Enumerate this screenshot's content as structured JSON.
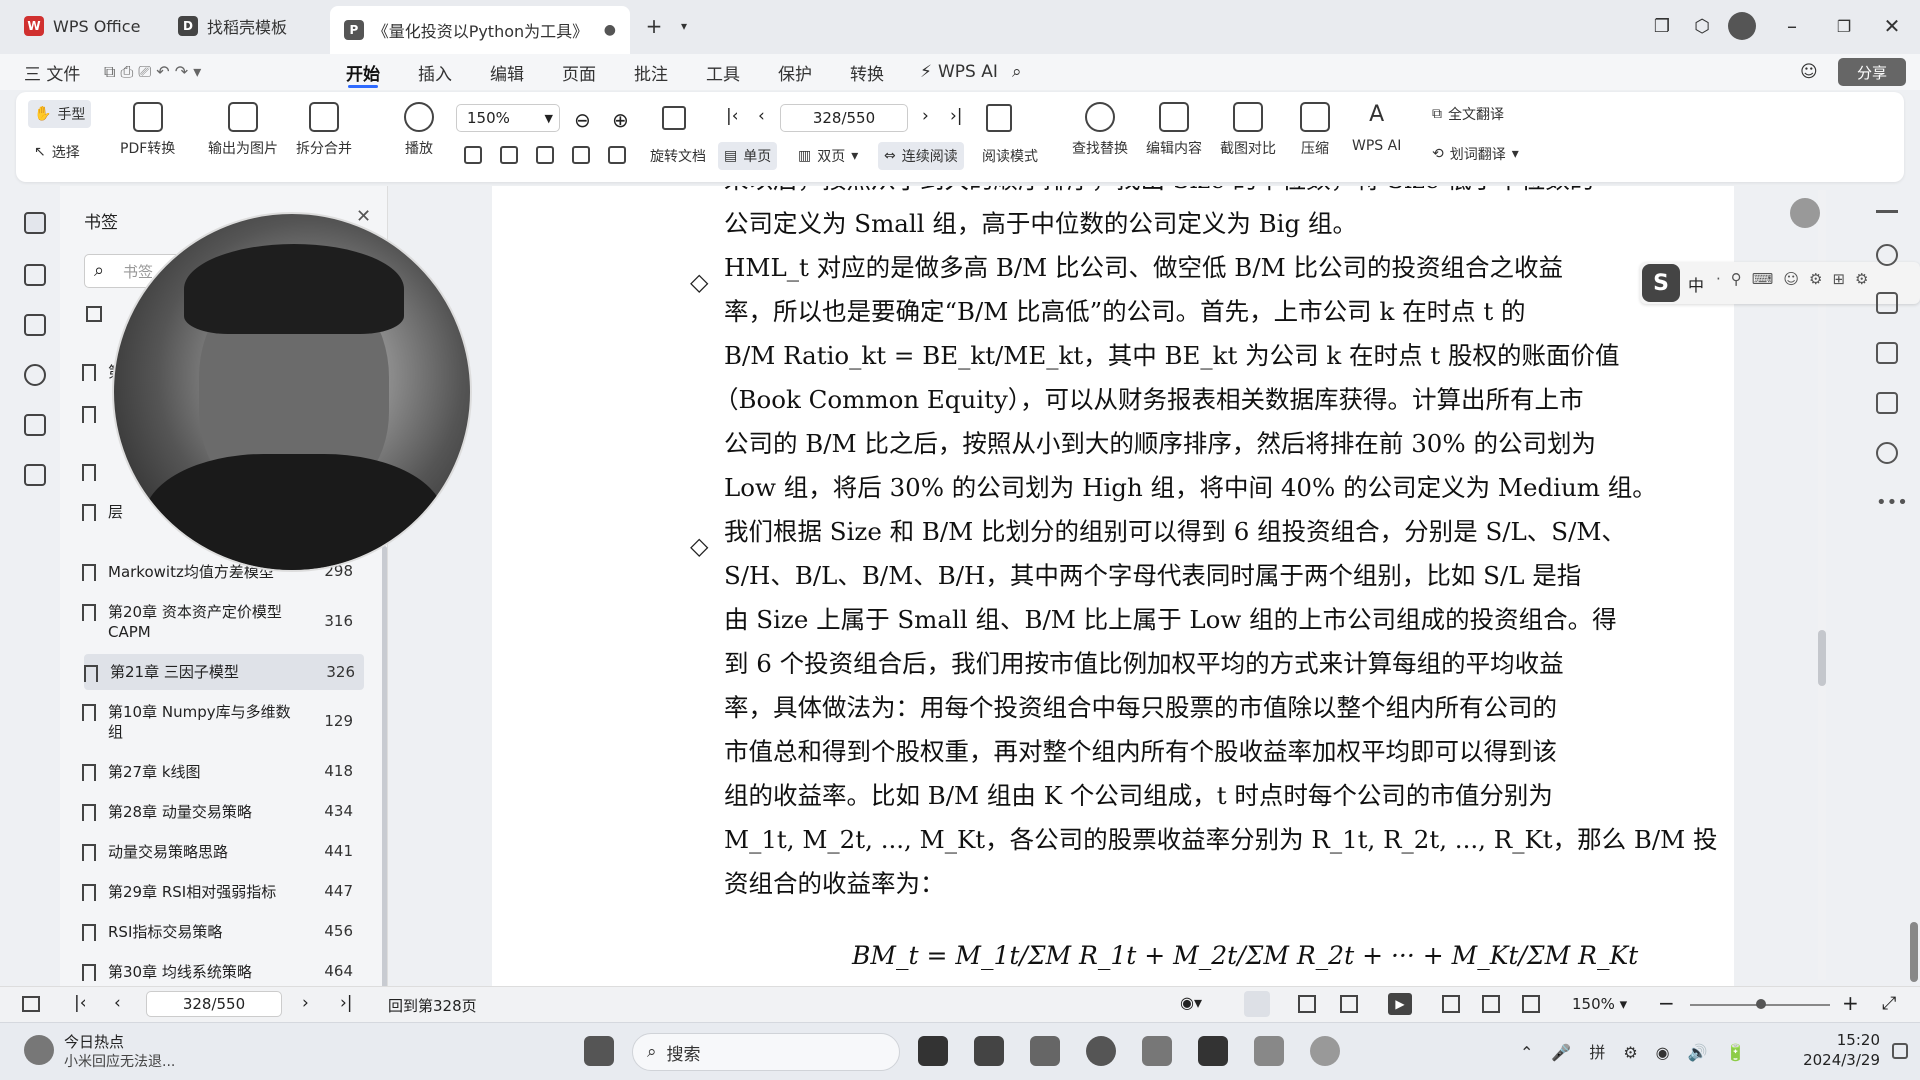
{
  "tabs": [
    {
      "label": "WPS Office",
      "icon": "wps-logo-icon"
    },
    {
      "label": "找稻壳模板",
      "icon": "docer-icon"
    },
    {
      "label": "《量化投资以Python为工具》",
      "icon": "pdf-doc-icon"
    }
  ],
  "menu": {
    "file": "三 文件",
    "items": [
      "开始",
      "插入",
      "编辑",
      "页面",
      "批注",
      "工具",
      "保护",
      "转换"
    ],
    "wps_ai": "WPS AI",
    "share": "分享",
    "active": "开始"
  },
  "ribbon": {
    "hand": "手型",
    "select": "选择",
    "pdf_convert": "PDF转换",
    "export_img": "输出为图片",
    "split_merge": "拆分合并",
    "play": "播放",
    "zoom": "150%",
    "page_value": "328/550",
    "rotate": "旋转文档",
    "single": "单页",
    "double": "双页",
    "continuous": "连续阅读",
    "reading": "阅读模式",
    "find_replace": "查找替换",
    "edit_content": "编辑内容",
    "screenshot": "截图对比",
    "compress": "压缩",
    "wps_ai": "WPS AI",
    "full_translate": "全文翻译",
    "word_translate": "划词翻译"
  },
  "bookmarks": {
    "title": "书签",
    "search_placeholder": "书签",
    "items": [
      {
        "title": "第1",
        "page": ""
      },
      {
        "title": "层",
        "page": ""
      },
      {
        "title": "Markowitz均值方差模型",
        "page": "298"
      },
      {
        "title": "第20章 资本资产定价模型 CAPM",
        "page": "316"
      },
      {
        "title": "第21章 三因子模型",
        "page": "326"
      },
      {
        "title": "第10章 Numpy库与多维数组",
        "page": "129"
      },
      {
        "title": "第27章 k线图",
        "page": "418"
      },
      {
        "title": "第28章 动量交易策略",
        "page": "434"
      },
      {
        "title": "动量交易策略思路",
        "page": "441"
      },
      {
        "title": "第29章 RSI相对强弱指标",
        "page": "447"
      },
      {
        "title": "RSI指标交易策略",
        "page": "456"
      },
      {
        "title": "第30章 均线系统策略",
        "page": "464"
      }
    ]
  },
  "document": {
    "lines": [
      "来以后，按照从小到大的顺序排序，找出 Size 的中位数，将 Size 低于中位数的",
      "公司定义为 Small 组，高于中位数的公司定义为 Big 组。",
      "HML_t 对应的是做多高 B/M 比公司、做空低 B/M 比公司的投资组合之收益",
      "率，所以也是要确定“B/M 比高低”的公司。首先，上市公司 k 在时点 t 的",
      "B/M Ratio_kt = BE_kt/ME_kt，其中 BE_kt 为公司 k 在时点 t 股权的账面价值",
      "（Book Common Equity），可以从财务报表相关数据库获得。计算出所有上市",
      "公司的 B/M 比之后，按照从小到大的顺序排序，然后将排在前 30% 的公司划为",
      "Low 组，将后 30% 的公司划为 High 组，将中间 40% 的公司定义为 Medium 组。",
      "我们根据 Size 和 B/M 比划分的组别可以得到 6 组投资组合，分别是 S/L、S/M、",
      "S/H、B/L、B/M、B/H，其中两个字母代表同时属于两个组别，比如 S/L 是指",
      "由 Size 上属于 Small 组、B/M 比上属于 Low 组的上市公司组成的投资组合。得",
      "到 6 个投资组合后，我们用按市值比例加权平均的方式来计算每组的平均收益",
      "率，具体做法为：用每个投资组合中每只股票的市值除以整个组内所有公司的",
      "市值总和得到个股权重，再对整个组内所有个股收益率加权平均即可以得到该",
      "组的收益率。比如 B/M 组由 K 个公司组成，t 时点时每个公司的市值分别为",
      "M_1t, M_2t, ..., M_Kt，各公司的股票收益率分别为 R_1t, R_2t, ..., R_Kt，那么 B/M 投",
      "资组合的收益率为："
    ],
    "formula": "BM_t = M_1t/ΣM R_1t + M_2t/ΣM R_2t + ··· + M_Kt/ΣM R_Kt"
  },
  "status": {
    "page": "328/550",
    "goto": "回到第328页",
    "zoom": "150%"
  },
  "taskbar": {
    "news_title": "今日热点",
    "news_sub": "小米回应无法退...",
    "search": "搜索",
    "time": "15:20",
    "date": "2024/3/29"
  },
  "ime": {
    "label": "中"
  }
}
